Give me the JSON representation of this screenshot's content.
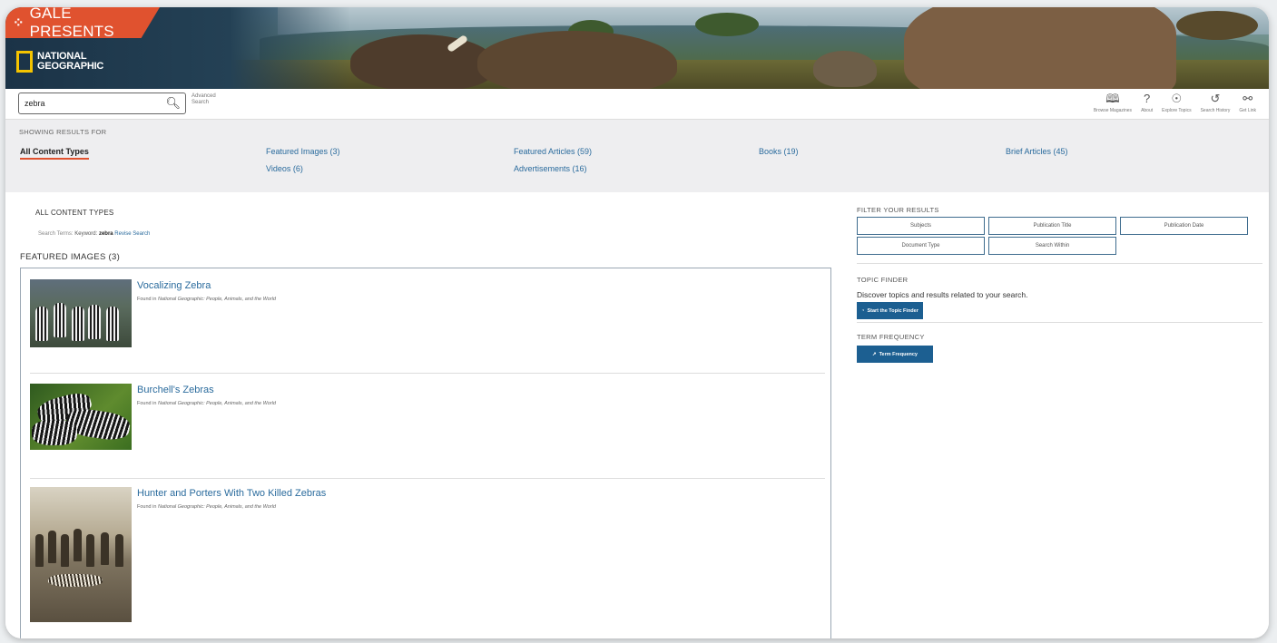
{
  "header": {
    "brand_badge": "GALE PRESENTS",
    "brand_mark": "⁘",
    "logo_text": "NATIONAL\nGEOGRAPHIC",
    "logo_line1": "NATIONAL",
    "logo_line2": "GEOGRAPHIC",
    "accent_color": "#e0522f",
    "logo_color": "#f5c400"
  },
  "search": {
    "value": "zebra",
    "icon": "search-icon",
    "advanced_label": "Advanced Search"
  },
  "toolbar": {
    "items": [
      {
        "label": "Browse Magazines",
        "icon": "book-icon"
      },
      {
        "label": "About",
        "icon": "question-icon"
      },
      {
        "label": "Explore Topics",
        "icon": "lightbulb-icon"
      },
      {
        "label": "Search History",
        "icon": "history-icon"
      },
      {
        "label": "Get Link",
        "icon": "link-icon"
      }
    ]
  },
  "results_for": {
    "heading": "SHOWING RESULTS FOR",
    "types": [
      {
        "label": "All Content Types",
        "active": true
      },
      {
        "label": "Featured Images (3)",
        "active": false
      },
      {
        "label": "Videos (6)",
        "active": false
      },
      {
        "label": "Featured Articles (59)",
        "active": false
      },
      {
        "label": "Advertisements (16)",
        "active": false
      },
      {
        "label": "Books (19)",
        "active": false
      },
      {
        "label": "Brief Articles (45)",
        "active": false
      }
    ]
  },
  "main": {
    "section_title": "ALL CONTENT TYPES",
    "search_terms_prefix": "Search Terms:",
    "keyword_label": "Keyword:",
    "keyword_value": "zebra",
    "revise_label": "Revise Search",
    "featured_heading": "FEATURED IMAGES (3)",
    "results": [
      {
        "title": "Vocalizing Zebra",
        "found_prefix": "Found in ",
        "source": "National Geographic: People, Animals, and the World"
      },
      {
        "title": "Burchell's Zebras",
        "found_prefix": "Found in ",
        "source": "National Geographic: People, Animals, and the World"
      },
      {
        "title": "Hunter and Porters With Two Killed Zebras",
        "found_prefix": "Found in ",
        "source": "National Geographic: People, Animals, and the World"
      }
    ]
  },
  "sidebar": {
    "filter_heading": "FILTER YOUR RESULTS",
    "filters": [
      "Subjects",
      "Publication Title",
      "Publication Date",
      "Document Type",
      "Search Within"
    ],
    "topic_heading": "TOPIC FINDER",
    "topic_desc": "Discover topics and results related to your search.",
    "topic_button": "Start the Topic Finder",
    "term_heading": "TERM FREQUENCY",
    "term_button": "Term Frequency",
    "button_color": "#1c5f91"
  }
}
